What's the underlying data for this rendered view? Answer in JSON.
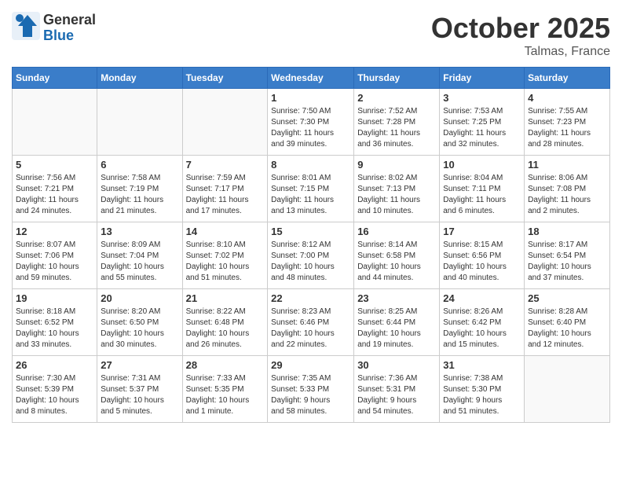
{
  "header": {
    "logo_general": "General",
    "logo_blue": "Blue",
    "month": "October 2025",
    "location": "Talmas, France"
  },
  "days_of_week": [
    "Sunday",
    "Monday",
    "Tuesday",
    "Wednesday",
    "Thursday",
    "Friday",
    "Saturday"
  ],
  "weeks": [
    [
      {
        "num": "",
        "info": ""
      },
      {
        "num": "",
        "info": ""
      },
      {
        "num": "",
        "info": ""
      },
      {
        "num": "1",
        "info": "Sunrise: 7:50 AM\nSunset: 7:30 PM\nDaylight: 11 hours\nand 39 minutes."
      },
      {
        "num": "2",
        "info": "Sunrise: 7:52 AM\nSunset: 7:28 PM\nDaylight: 11 hours\nand 36 minutes."
      },
      {
        "num": "3",
        "info": "Sunrise: 7:53 AM\nSunset: 7:25 PM\nDaylight: 11 hours\nand 32 minutes."
      },
      {
        "num": "4",
        "info": "Sunrise: 7:55 AM\nSunset: 7:23 PM\nDaylight: 11 hours\nand 28 minutes."
      }
    ],
    [
      {
        "num": "5",
        "info": "Sunrise: 7:56 AM\nSunset: 7:21 PM\nDaylight: 11 hours\nand 24 minutes."
      },
      {
        "num": "6",
        "info": "Sunrise: 7:58 AM\nSunset: 7:19 PM\nDaylight: 11 hours\nand 21 minutes."
      },
      {
        "num": "7",
        "info": "Sunrise: 7:59 AM\nSunset: 7:17 PM\nDaylight: 11 hours\nand 17 minutes."
      },
      {
        "num": "8",
        "info": "Sunrise: 8:01 AM\nSunset: 7:15 PM\nDaylight: 11 hours\nand 13 minutes."
      },
      {
        "num": "9",
        "info": "Sunrise: 8:02 AM\nSunset: 7:13 PM\nDaylight: 11 hours\nand 10 minutes."
      },
      {
        "num": "10",
        "info": "Sunrise: 8:04 AM\nSunset: 7:11 PM\nDaylight: 11 hours\nand 6 minutes."
      },
      {
        "num": "11",
        "info": "Sunrise: 8:06 AM\nSunset: 7:08 PM\nDaylight: 11 hours\nand 2 minutes."
      }
    ],
    [
      {
        "num": "12",
        "info": "Sunrise: 8:07 AM\nSunset: 7:06 PM\nDaylight: 10 hours\nand 59 minutes."
      },
      {
        "num": "13",
        "info": "Sunrise: 8:09 AM\nSunset: 7:04 PM\nDaylight: 10 hours\nand 55 minutes."
      },
      {
        "num": "14",
        "info": "Sunrise: 8:10 AM\nSunset: 7:02 PM\nDaylight: 10 hours\nand 51 minutes."
      },
      {
        "num": "15",
        "info": "Sunrise: 8:12 AM\nSunset: 7:00 PM\nDaylight: 10 hours\nand 48 minutes."
      },
      {
        "num": "16",
        "info": "Sunrise: 8:14 AM\nSunset: 6:58 PM\nDaylight: 10 hours\nand 44 minutes."
      },
      {
        "num": "17",
        "info": "Sunrise: 8:15 AM\nSunset: 6:56 PM\nDaylight: 10 hours\nand 40 minutes."
      },
      {
        "num": "18",
        "info": "Sunrise: 8:17 AM\nSunset: 6:54 PM\nDaylight: 10 hours\nand 37 minutes."
      }
    ],
    [
      {
        "num": "19",
        "info": "Sunrise: 8:18 AM\nSunset: 6:52 PM\nDaylight: 10 hours\nand 33 minutes."
      },
      {
        "num": "20",
        "info": "Sunrise: 8:20 AM\nSunset: 6:50 PM\nDaylight: 10 hours\nand 30 minutes."
      },
      {
        "num": "21",
        "info": "Sunrise: 8:22 AM\nSunset: 6:48 PM\nDaylight: 10 hours\nand 26 minutes."
      },
      {
        "num": "22",
        "info": "Sunrise: 8:23 AM\nSunset: 6:46 PM\nDaylight: 10 hours\nand 22 minutes."
      },
      {
        "num": "23",
        "info": "Sunrise: 8:25 AM\nSunset: 6:44 PM\nDaylight: 10 hours\nand 19 minutes."
      },
      {
        "num": "24",
        "info": "Sunrise: 8:26 AM\nSunset: 6:42 PM\nDaylight: 10 hours\nand 15 minutes."
      },
      {
        "num": "25",
        "info": "Sunrise: 8:28 AM\nSunset: 6:40 PM\nDaylight: 10 hours\nand 12 minutes."
      }
    ],
    [
      {
        "num": "26",
        "info": "Sunrise: 7:30 AM\nSunset: 5:39 PM\nDaylight: 10 hours\nand 8 minutes."
      },
      {
        "num": "27",
        "info": "Sunrise: 7:31 AM\nSunset: 5:37 PM\nDaylight: 10 hours\nand 5 minutes."
      },
      {
        "num": "28",
        "info": "Sunrise: 7:33 AM\nSunset: 5:35 PM\nDaylight: 10 hours\nand 1 minute."
      },
      {
        "num": "29",
        "info": "Sunrise: 7:35 AM\nSunset: 5:33 PM\nDaylight: 9 hours\nand 58 minutes."
      },
      {
        "num": "30",
        "info": "Sunrise: 7:36 AM\nSunset: 5:31 PM\nDaylight: 9 hours\nand 54 minutes."
      },
      {
        "num": "31",
        "info": "Sunrise: 7:38 AM\nSunset: 5:30 PM\nDaylight: 9 hours\nand 51 minutes."
      },
      {
        "num": "",
        "info": ""
      }
    ]
  ]
}
